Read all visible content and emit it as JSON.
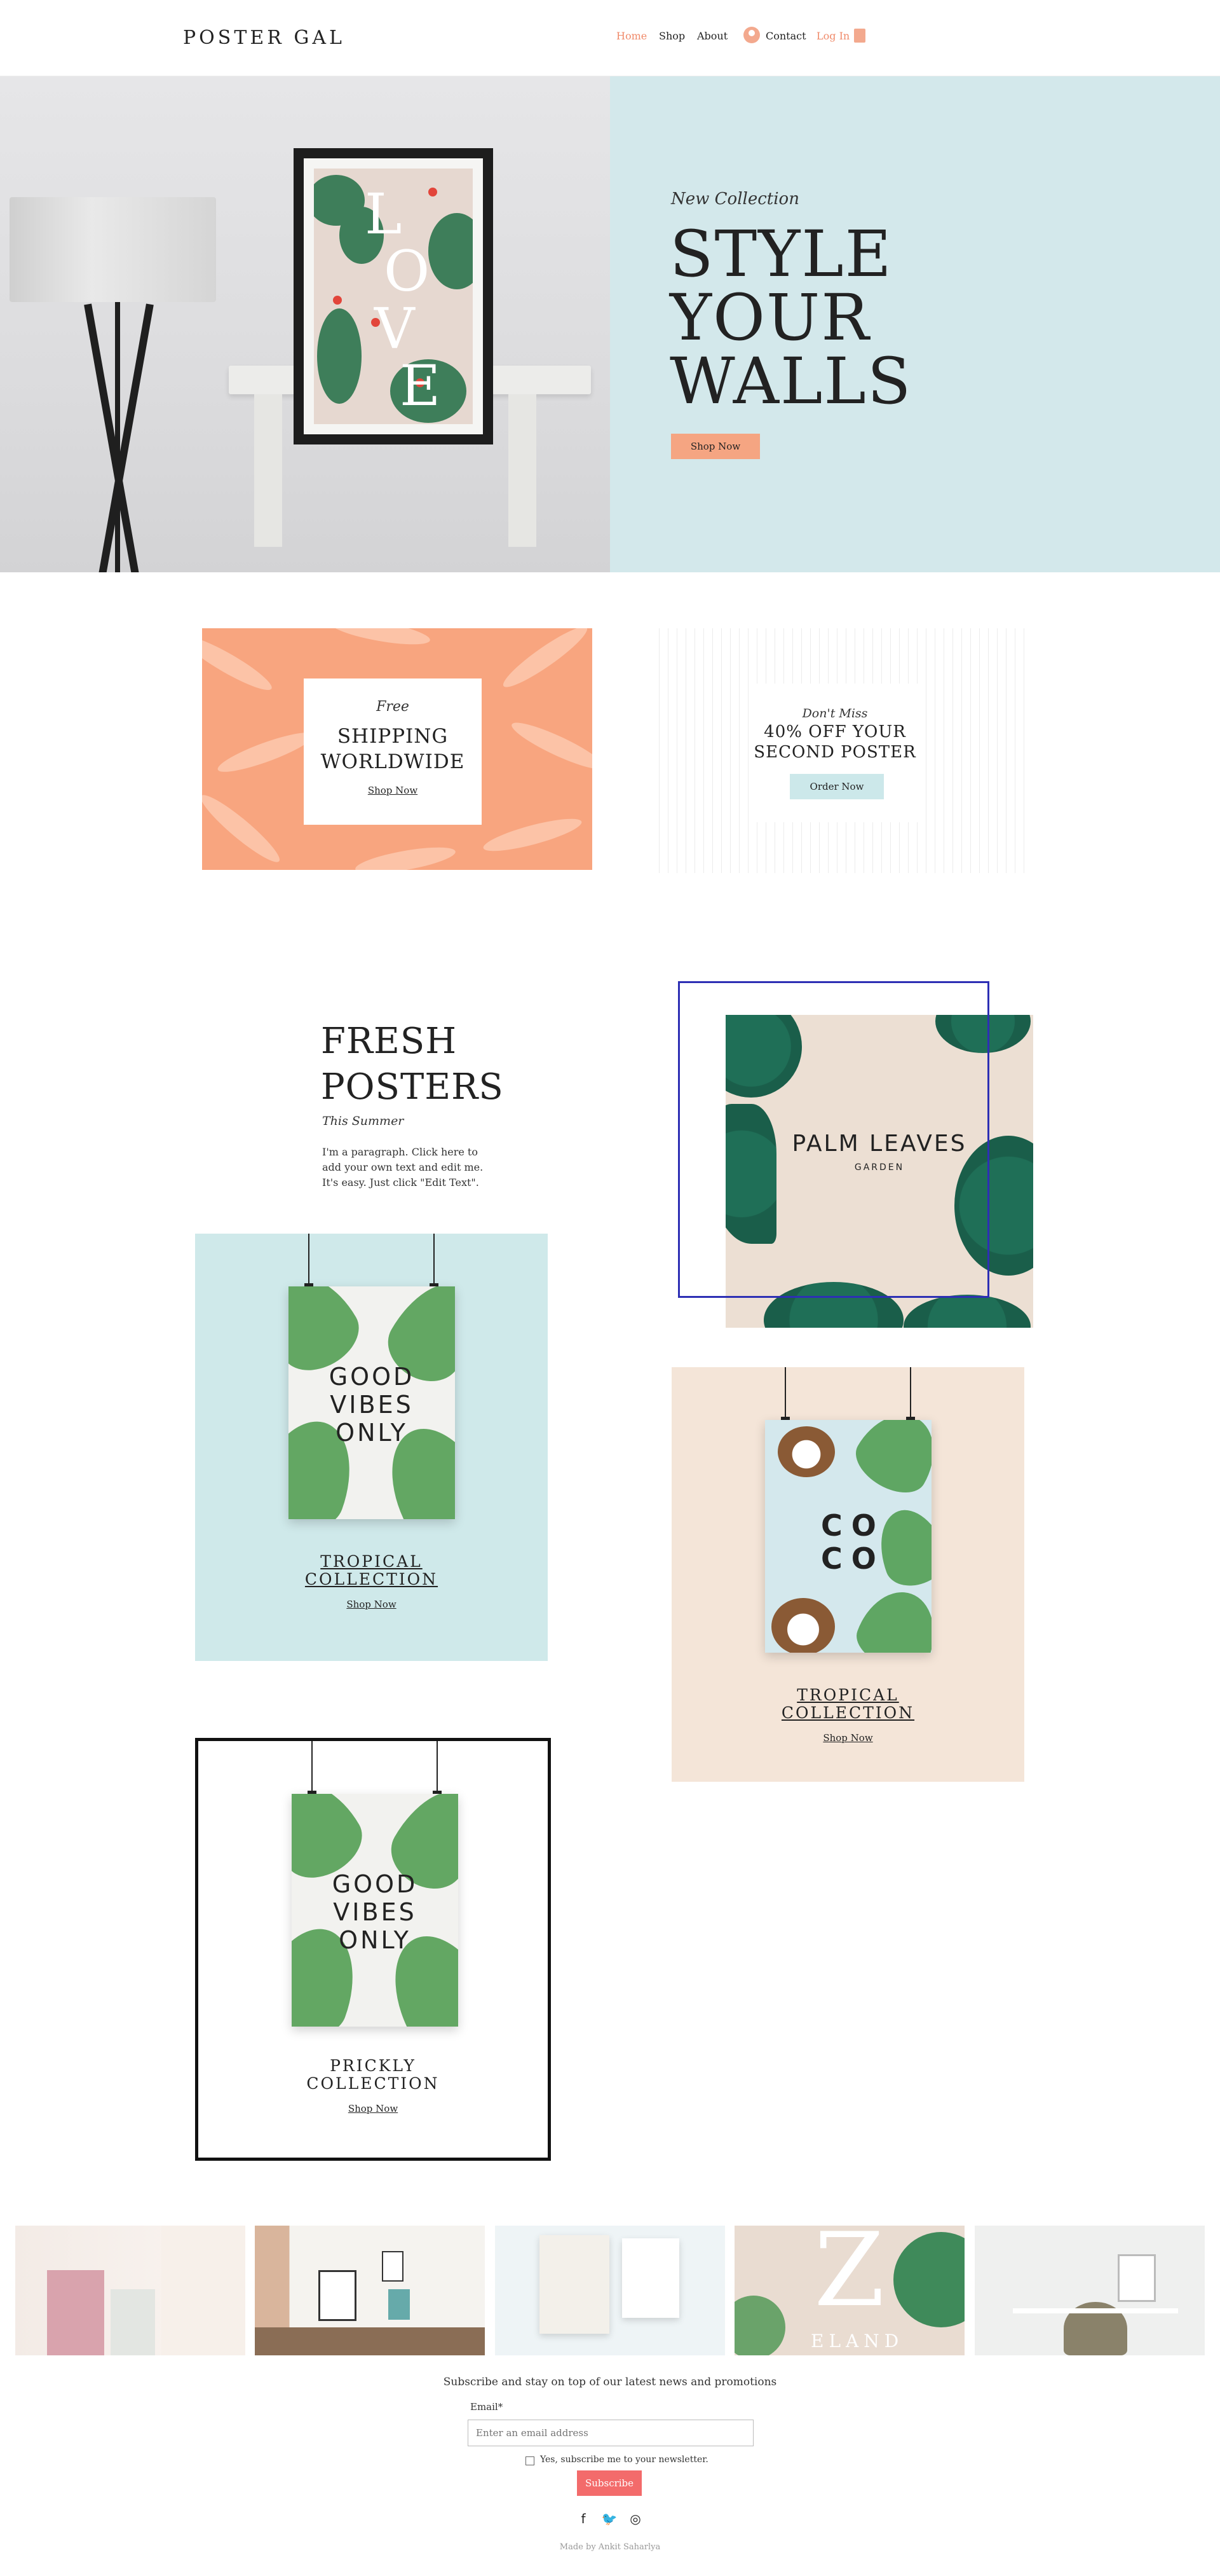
{
  "header": {
    "logo": "POSTER GAL",
    "nav": [
      "Home",
      "Shop",
      "About",
      "Contact",
      "Log In"
    ],
    "accent": "#f08a6a"
  },
  "hero": {
    "kicker": "New Collection",
    "title_lines": [
      "STYLE",
      "YOUR",
      "WALLS"
    ],
    "button": "Shop Now",
    "poster_letters": [
      "L",
      "O",
      "V",
      "E"
    ],
    "bg_color": "#d3e8eb",
    "button_color": "#f5a582"
  },
  "promos": [
    {
      "kicker": "Free",
      "title_lines": [
        "SHIPPING",
        "WORLDWIDE"
      ],
      "link": "Shop Now",
      "color": "#f8a57f"
    },
    {
      "kicker": "Don't Miss",
      "title_lines": [
        "40% OFF YOUR",
        "SECOND POSTER"
      ],
      "button": "Order Now",
      "button_color": "#cce8ea"
    }
  ],
  "fresh": {
    "title_lines": [
      "FRESH",
      "POSTERS"
    ],
    "kicker": "This Summer",
    "paragraph": "I'm a paragraph. Click here to add your own text and edit me. It's easy. Just click \"Edit Text\"."
  },
  "feature": {
    "title": "PALM LEAVES",
    "subtitle": "GARDEN"
  },
  "collections": [
    {
      "poster_lines": [
        "GOOD",
        "VIBES",
        "ONLY"
      ],
      "title_lines": [
        "TROPICAL",
        "COLLECTION"
      ],
      "link": "Shop Now",
      "color": "#cfe9ea"
    },
    {
      "poster_lines": [
        "CO",
        "CO"
      ],
      "title_lines": [
        "TROPICAL",
        "COLLECTION"
      ],
      "link": "Shop Now",
      "color": "#f4e5d8"
    },
    {
      "poster_lines": [
        "GOOD",
        "VIBES",
        "ONLY"
      ],
      "title_lines": [
        "PRICKLY",
        "COLLECTION"
      ],
      "link": "Shop Now",
      "color": "#ffffff"
    }
  ],
  "gallery": {
    "tile4_letter": "Z",
    "tile4_text": "ELAND"
  },
  "newsletter": {
    "heading": "Subscribe and stay on top of our latest news and promotions",
    "email_label": "Email*",
    "email_placeholder": "Enter an email address",
    "consent": "Yes, subscribe me to your newsletter.",
    "button": "Subscribe",
    "button_color": "#f36b6b"
  },
  "social": [
    {
      "icon": "facebook-icon",
      "glyph": "f"
    },
    {
      "icon": "twitter-icon",
      "glyph": "🐦"
    },
    {
      "icon": "instagram-icon",
      "glyph": "◎"
    }
  ],
  "footer": {
    "made_by": "Made by Ankit Saharlya"
  }
}
